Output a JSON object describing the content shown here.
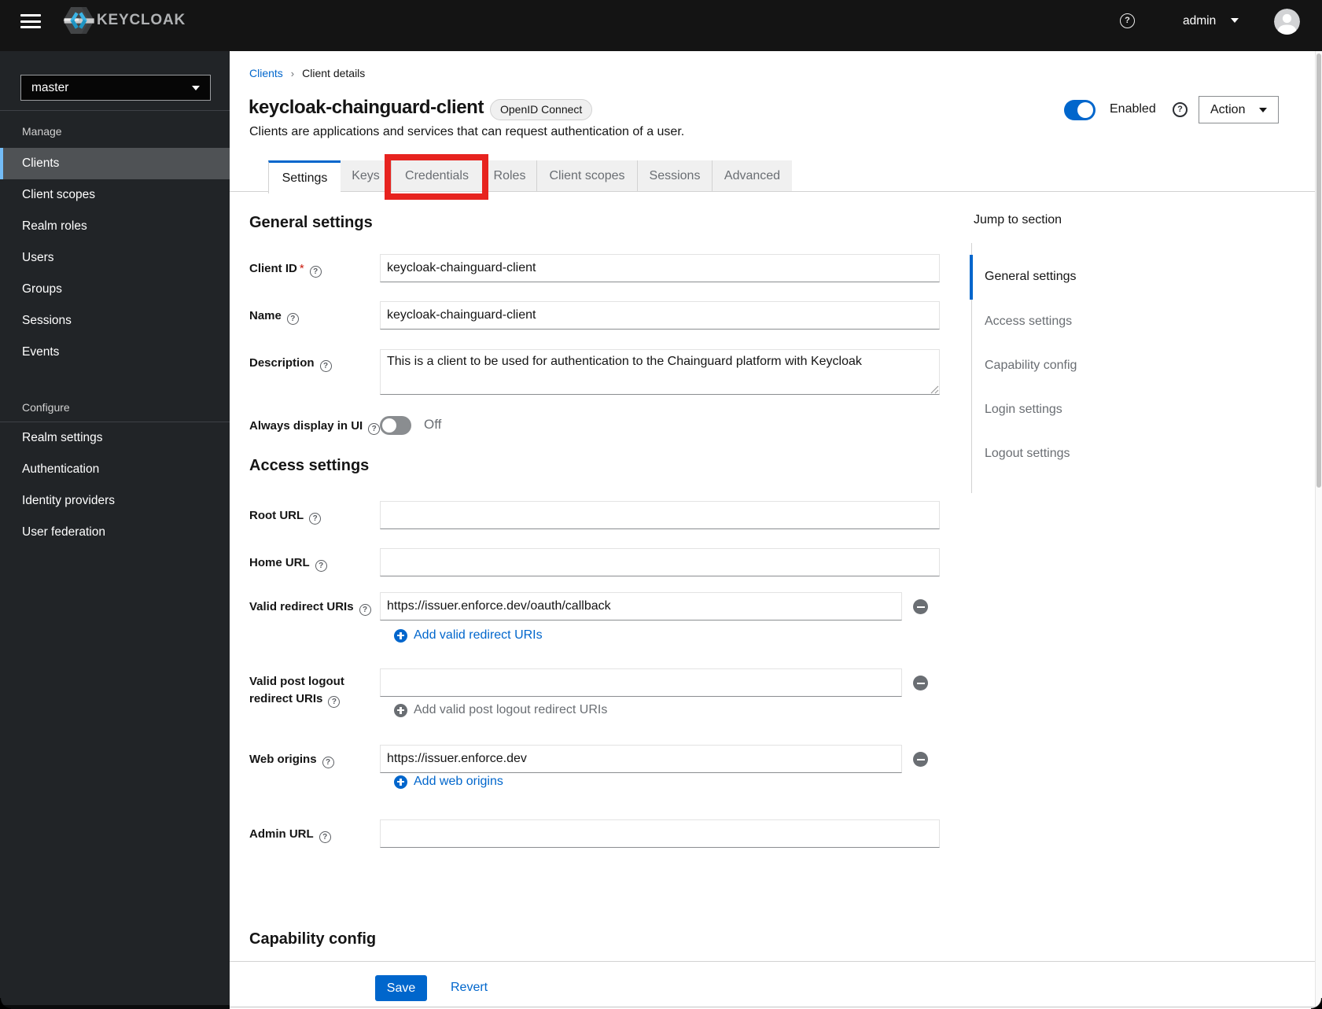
{
  "masthead": {
    "brand": "KEYCLOAK",
    "user": "admin"
  },
  "sidebar": {
    "realm": "master",
    "manage_label": "Manage",
    "configure_label": "Configure",
    "manage_items": [
      "Clients",
      "Client scopes",
      "Realm roles",
      "Users",
      "Groups",
      "Sessions",
      "Events"
    ],
    "configure_items": [
      "Realm settings",
      "Authentication",
      "Identity providers",
      "User federation"
    ],
    "selected_item": "Clients"
  },
  "breadcrumb": {
    "parent": "Clients",
    "separator": "›",
    "current": "Client details"
  },
  "header": {
    "title": "keycloak-chainguard-client",
    "badge": "OpenID Connect",
    "subtitle": "Clients are applications and services that can request authentication of a user.",
    "enabled_label": "Enabled",
    "action_label": "Action"
  },
  "tabs": {
    "items": [
      "Settings",
      "Keys",
      "Credentials",
      "Roles",
      "Client scopes",
      "Sessions",
      "Advanced"
    ],
    "active": "Settings",
    "highlighted": "Credentials"
  },
  "form": {
    "general": {
      "heading": "General settings",
      "client_id": {
        "label": "Client ID",
        "required_marker": "*",
        "value": "keycloak-chainguard-client"
      },
      "name": {
        "label": "Name",
        "value": "keycloak-chainguard-client"
      },
      "description": {
        "label": "Description",
        "value": "This is a client to be used for authentication to the Chainguard platform with Keycloak"
      },
      "always_display": {
        "label": "Always display in UI",
        "state": "Off"
      }
    },
    "access": {
      "heading": "Access settings",
      "root_url": {
        "label": "Root URL",
        "value": ""
      },
      "home_url": {
        "label": "Home URL",
        "value": ""
      },
      "redirect_uris": {
        "label": "Valid redirect URIs",
        "value": "https://issuer.enforce.dev/oauth/callback",
        "add_label": "Add valid redirect URIs"
      },
      "post_logout_uris": {
        "label": "Valid post logout redirect URIs",
        "value": "",
        "add_label": "Add valid post logout redirect URIs"
      },
      "web_origins": {
        "label": "Web origins",
        "value": "https://issuer.enforce.dev",
        "add_label": "Add web origins"
      },
      "admin_url": {
        "label": "Admin URL",
        "value": ""
      }
    },
    "capability": {
      "heading": "Capability config"
    }
  },
  "jump": {
    "title": "Jump to section",
    "items": [
      "General settings",
      "Access settings",
      "Capability config",
      "Login settings",
      "Logout settings"
    ],
    "active": "General settings"
  },
  "footer": {
    "save": "Save",
    "revert": "Revert"
  },
  "toggles": {
    "enabled_on": true,
    "always_display_on": false
  },
  "colors": {
    "accent": "#0066cc",
    "highlight_red": "#e7231f",
    "masthead_bg": "#141414",
    "sidebar_bg": "#212427",
    "selected_bg": "#4f5255",
    "selected_bar": "#73bcf7",
    "tab_inactive_bg": "#f0f0f0",
    "logo_cyan": "#33a9d9"
  }
}
